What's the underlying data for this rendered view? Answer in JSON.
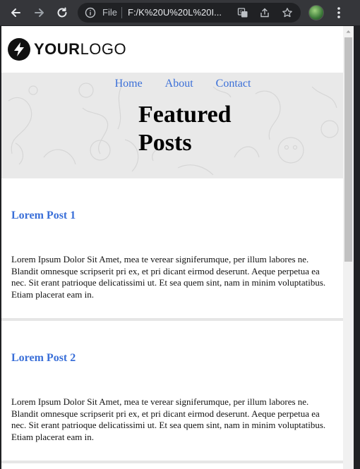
{
  "browser": {
    "file_label": "File",
    "url": "F:/K%20U%20L%20I..."
  },
  "logo": {
    "bold": "YOUR",
    "light": "LOGO"
  },
  "nav": {
    "items": [
      "Home",
      "About",
      "Contact"
    ]
  },
  "hero": {
    "title": "Featured Posts"
  },
  "posts": [
    {
      "title": "Lorem Post 1",
      "body": "Lorem Ipsum Dolor Sit Amet, mea te verear signiferumque, per illum labores ne. Blandit omnesque scripserit pri ex, et pri dicant eirmod deserunt. Aeque perpetua ea nec. Sit erant patrioque delicatissimi ut. Et sea quem sint, nam in minim voluptatibus. Etiam placerat eam in."
    },
    {
      "title": "Lorem Post 2",
      "body": "Lorem Ipsum Dolor Sit Amet, mea te verear signiferumque, per illum labores ne. Blandit omnesque scripserit pri ex, et pri dicant eirmod deserunt. Aeque perpetua ea nec. Sit erant patrioque delicatissimi ut. Et sea quem sint, nam in minim voluptatibus. Etiam placerat eam in."
    }
  ],
  "colors": {
    "link": "#3a6fd8",
    "hero_bg": "#e9e9e9",
    "toolbar_bg": "#35363a"
  },
  "icons": [
    "back-arrow-icon",
    "forward-arrow-icon",
    "reload-icon",
    "info-icon",
    "translate-icon",
    "share-icon",
    "star-icon",
    "profile-avatar",
    "menu-kebab-icon",
    "lightning-bolt-icon"
  ]
}
